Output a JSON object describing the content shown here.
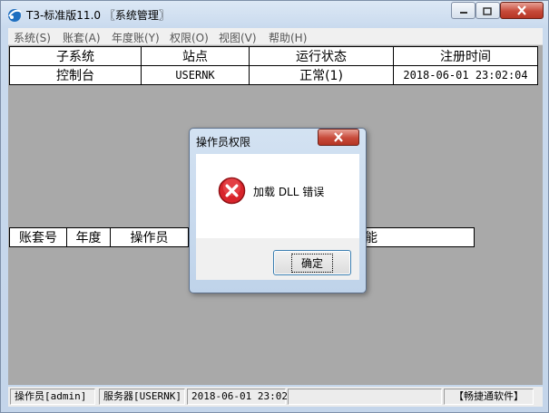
{
  "window": {
    "title": "T3-标准版11.0 〖系统管理〗",
    "close_color": "#c74a3a"
  },
  "menu": [
    "系统(S)",
    "账套(A)",
    "年度账(Y)",
    "权限(O)",
    "视图(V)",
    "帮助(H)"
  ],
  "top_table": {
    "headers": [
      "子系统",
      "站点",
      "运行状态",
      "注册时间"
    ],
    "rows": [
      [
        "控制台",
        "USERNK",
        "正常(1)",
        "2018-06-01 23:02:04"
      ]
    ]
  },
  "bottom_table": {
    "headers": [
      "账套号",
      "年度",
      "操作员",
      "",
      "能"
    ]
  },
  "dialog": {
    "title": "操作员权限",
    "message": "加载 DLL 错误",
    "ok_label": "确定",
    "icon": "error-icon"
  },
  "statusbar": {
    "operator": "操作员[admin]",
    "server": "服务器[USERNK]",
    "datetime": "2018-06-01 23:02",
    "company": "【畅捷通软件】"
  }
}
